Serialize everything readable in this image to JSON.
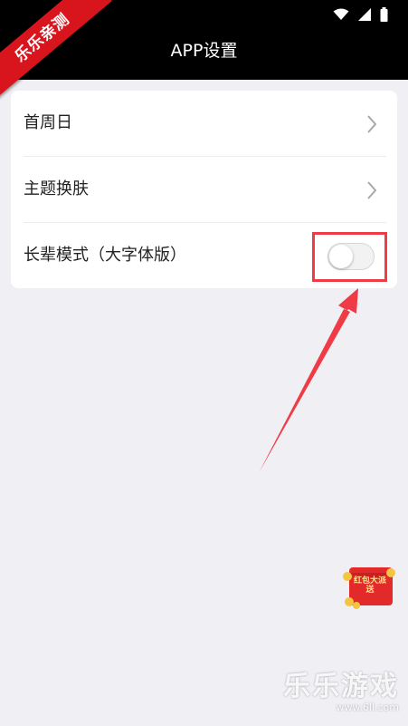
{
  "status_bar": {
    "icons": [
      "wifi-icon",
      "signal-icon",
      "battery-icon"
    ]
  },
  "header": {
    "title": "APP设置",
    "back_icon": "chevron-left-icon"
  },
  "ribbon": {
    "text": "乐乐亲测"
  },
  "settings": {
    "items": [
      {
        "label": "首周日",
        "control": "chevron-right-icon"
      },
      {
        "label": "主题换肤",
        "control": "chevron-right-icon"
      },
      {
        "label": "长辈模式（大字体版）",
        "control": "toggle",
        "toggle_on": false
      }
    ]
  },
  "annotation": {
    "color": "#ee3b45"
  },
  "promo": {
    "text": "红包大派送"
  },
  "watermark": {
    "title": "乐乐游戏",
    "url": "www.6ll.com"
  },
  "colors": {
    "background": "#efeff4",
    "header_bg": "#000000",
    "ribbon": "#d8151d"
  }
}
